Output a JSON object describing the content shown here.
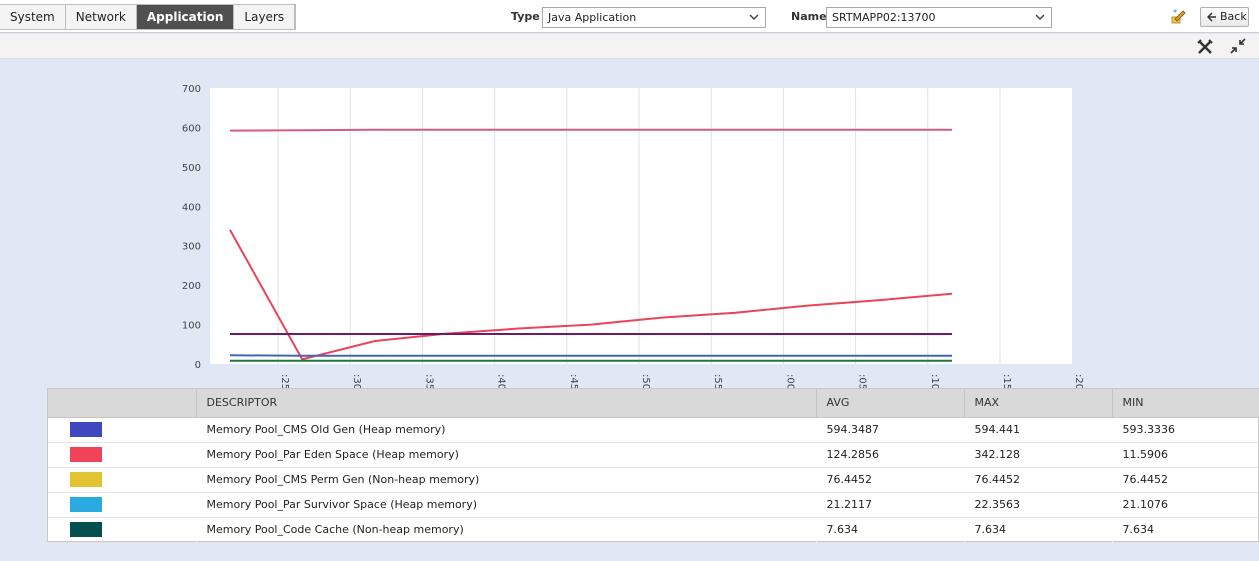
{
  "tabs": [
    "System",
    "Network",
    "Application",
    "Layers"
  ],
  "active_tab": "Application",
  "type_field": {
    "label": "Type",
    "value": "Java Application"
  },
  "name_field": {
    "label": "Name",
    "value": "SRTMAPP02:13700"
  },
  "back_label": "Back",
  "icons": {
    "edit": "edit-pencil-icon",
    "back": "back-arrow-icon",
    "tools": "tools-icon",
    "collapse": "collapse-icon"
  },
  "chart_data": {
    "type": "line",
    "ylim": [
      0,
      700
    ],
    "yticks": [
      0,
      100,
      200,
      300,
      400,
      500,
      600,
      700
    ],
    "xticks": [
      ":25",
      ":30",
      ":35",
      ":40",
      ":45",
      ":50",
      ":55",
      ":00",
      ":05",
      ":10",
      ":15",
      ":20"
    ],
    "x": [
      0,
      1,
      2,
      3,
      4,
      5,
      6,
      7,
      8,
      9,
      10,
      11
    ],
    "grid": true,
    "series": [
      {
        "color": "#d65c7f",
        "values": [
          592,
          593,
          594,
          594,
          594,
          594,
          594,
          594,
          594,
          594,
          594,
          594
        ]
      },
      {
        "color": "#e8455a",
        "values": [
          340,
          12,
          58,
          77,
          90,
          100,
          118,
          130,
          148,
          162,
          178,
          178
        ]
      },
      {
        "color": "#6a1b6e",
        "values": [
          76,
          76,
          76,
          76,
          76,
          76,
          76,
          76,
          76,
          76,
          76,
          76
        ]
      },
      {
        "color": "#4a63b5",
        "values": [
          22,
          21,
          21,
          21,
          21,
          21,
          21,
          21,
          21,
          21,
          21,
          21
        ]
      },
      {
        "color": "#1a7a3e",
        "values": [
          8,
          8,
          8,
          8,
          8,
          8,
          8,
          8,
          8,
          8,
          8,
          8
        ]
      }
    ]
  },
  "table": {
    "headers": [
      "",
      "DESCRIPTOR",
      "AVG",
      "MAX",
      "MIN"
    ],
    "rows": [
      {
        "color": "#3f48c0",
        "descriptor": "Memory Pool_CMS Old Gen (Heap memory)",
        "avg": "594.3487",
        "max": "594.441",
        "min": "593.3336"
      },
      {
        "color": "#f04258",
        "descriptor": "Memory Pool_Par Eden Space (Heap memory)",
        "avg": "124.2856",
        "max": "342.128",
        "min": "11.5906"
      },
      {
        "color": "#e2c332",
        "descriptor": "Memory Pool_CMS Perm Gen (Non-heap memory)",
        "avg": "76.4452",
        "max": "76.4452",
        "min": "76.4452"
      },
      {
        "color": "#29abe2",
        "descriptor": "Memory Pool_Par Survivor Space (Heap memory)",
        "avg": "21.2117",
        "max": "22.3563",
        "min": "21.1076"
      },
      {
        "color": "#03504f",
        "descriptor": "Memory Pool_Code Cache (Non-heap memory)",
        "avg": "7.634",
        "max": "7.634",
        "min": "7.634"
      }
    ]
  }
}
